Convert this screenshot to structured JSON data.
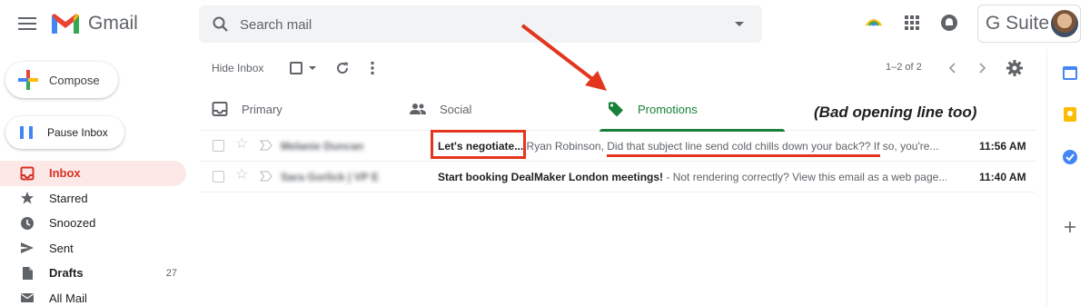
{
  "app": {
    "name": "Gmail"
  },
  "search": {
    "placeholder": "Search mail"
  },
  "header": {
    "gsuite_label": "G Suite"
  },
  "sidebar": {
    "compose_label": "Compose",
    "pause_label": "Pause Inbox",
    "items": [
      {
        "label": "Inbox",
        "icon": "inbox-icon"
      },
      {
        "label": "Starred",
        "icon": "star-icon"
      },
      {
        "label": "Snoozed",
        "icon": "clock-icon"
      },
      {
        "label": "Sent",
        "icon": "send-icon"
      },
      {
        "label": "Drafts",
        "icon": "draft-icon",
        "count": "27"
      },
      {
        "label": "All Mail",
        "icon": "mail-icon"
      }
    ]
  },
  "toolbar": {
    "hide_inbox_label": "Hide Inbox",
    "pager": "1–2 of 2"
  },
  "tabs": [
    {
      "label": "Primary",
      "icon": "inbox-icon"
    },
    {
      "label": "Social",
      "icon": "people-icon"
    },
    {
      "label": "Promotions",
      "icon": "tag-icon"
    }
  ],
  "emails": [
    {
      "sender": "Melanie Duncan",
      "subject": "Let's negotiate...",
      "snippet": " Ryan Robinson, Did that subject line send cold chills down your back?? If so, you're...",
      "time": "11:56 AM"
    },
    {
      "sender": "Sara Gorlick | VP E",
      "subject": "Start booking DealMaker London meetings!",
      "snippet": " - Not rendering correctly? View this email as a web page...",
      "time": "11:40 AM"
    }
  ],
  "annotation": {
    "text": "(Bad opening line too)"
  },
  "colors": {
    "accent_red": "#d93025",
    "promotions_green": "#188038",
    "annotation_red": "#e2371e"
  }
}
